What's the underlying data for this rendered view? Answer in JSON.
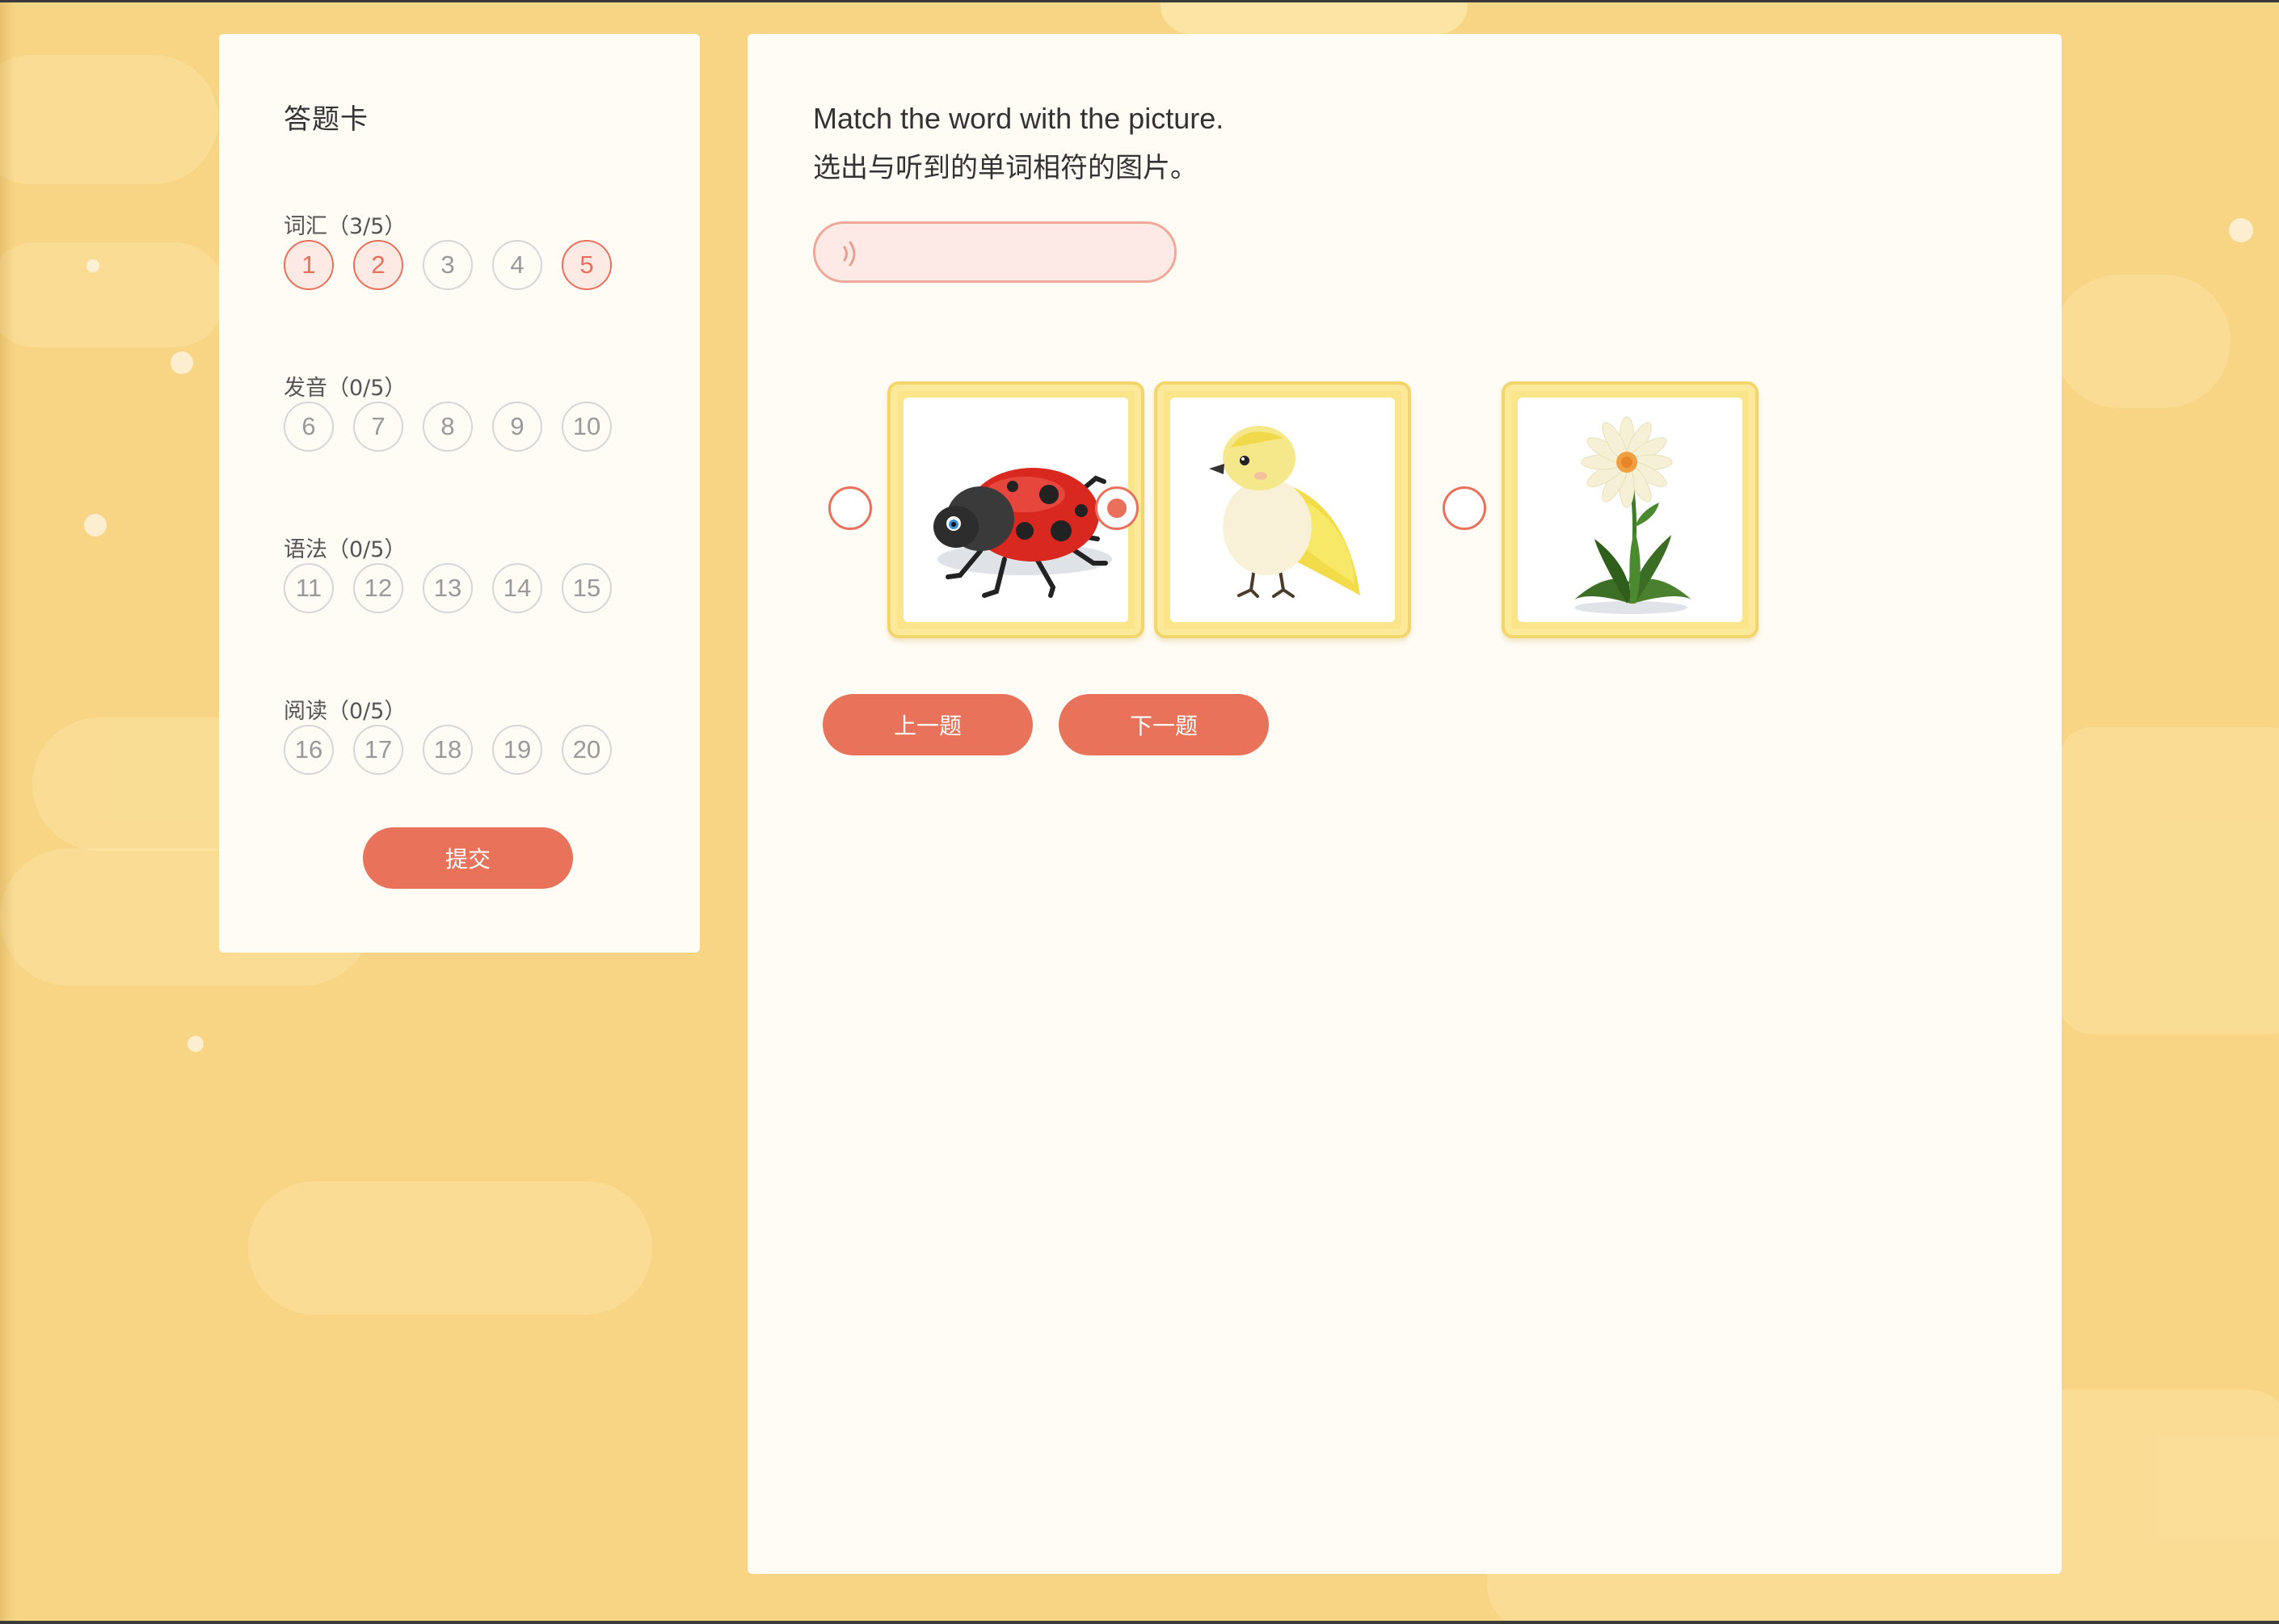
{
  "answer_card": {
    "title": "答题卡",
    "sections": [
      {
        "label": "词汇（3/5）",
        "numbers": [
          "1",
          "2",
          "3",
          "4",
          "5"
        ],
        "answered": [
          true,
          true,
          false,
          false,
          true
        ]
      },
      {
        "label": "发音（0/5）",
        "numbers": [
          "6",
          "7",
          "8",
          "9",
          "10"
        ],
        "answered": [
          false,
          false,
          false,
          false,
          false
        ]
      },
      {
        "label": "语法（0/5）",
        "numbers": [
          "11",
          "12",
          "13",
          "14",
          "15"
        ],
        "answered": [
          false,
          false,
          false,
          false,
          false
        ]
      },
      {
        "label": "阅读（0/5）",
        "numbers": [
          "16",
          "17",
          "18",
          "19",
          "20"
        ],
        "answered": [
          false,
          false,
          false,
          false,
          false
        ]
      }
    ],
    "submit_label": "提交"
  },
  "question": {
    "instruction_en": "Match the word with the picture.",
    "instruction_cn": "选出与听到的单词相符的图片。",
    "audio_icon": "speaker-wave-icon",
    "options": [
      {
        "picture": "ladybug",
        "selected": false
      },
      {
        "picture": "bird",
        "selected": true
      },
      {
        "picture": "daisy-flower",
        "selected": false
      }
    ]
  },
  "navigation": {
    "prev_label": "上一题",
    "next_label": "下一题"
  },
  "colors": {
    "accent": "#e8735a",
    "background": "#f8d585",
    "panel": "#fffcf5",
    "frame": "#fbe58a"
  }
}
